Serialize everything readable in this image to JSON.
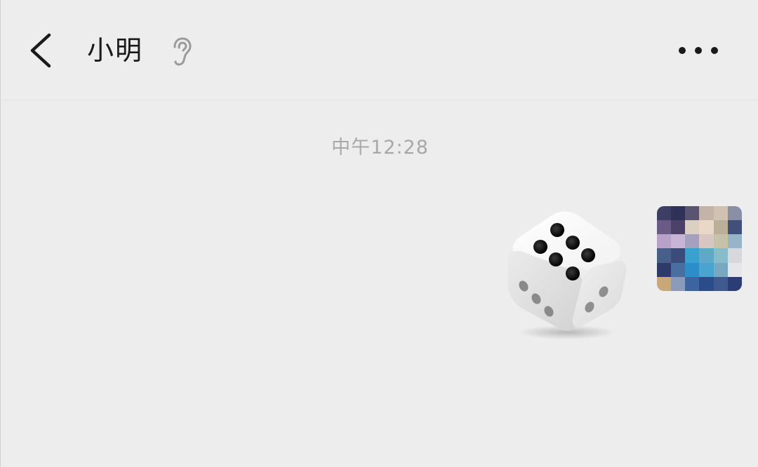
{
  "header": {
    "title": "小明",
    "back_icon": "chevron-left-icon",
    "voice_icon": "ear-icon",
    "more_icon": "more-horizontal-icon"
  },
  "chat": {
    "timestamp": "中午12:28",
    "messages": [
      {
        "type": "dice",
        "sender": "self",
        "dice_face": 6
      }
    ]
  },
  "colors": {
    "background": "#ededed",
    "title_text": "#1a1a1a",
    "timestamp_text": "#a8a8a8",
    "icon_dark": "#1a1a1a",
    "icon_light": "#9a9a9a"
  }
}
